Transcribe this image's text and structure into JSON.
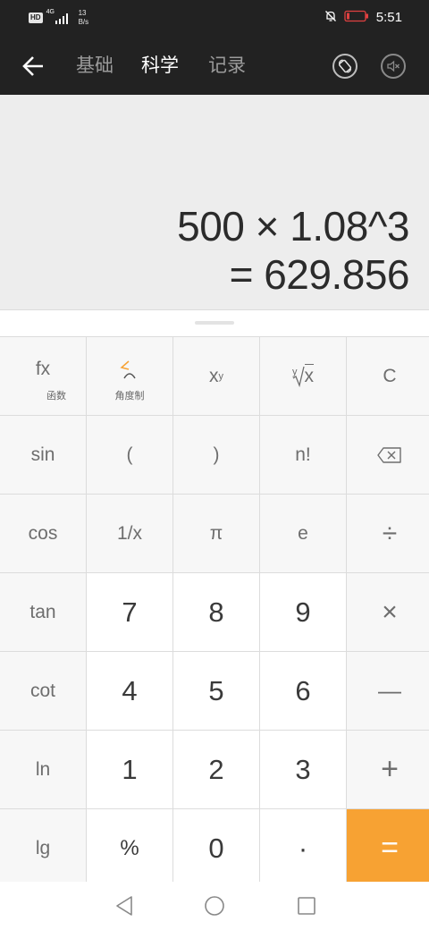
{
  "status_bar": {
    "hd": "HD",
    "signal": "4G",
    "net_speed_value": "13",
    "net_speed_unit": "B/s",
    "time": "5:51"
  },
  "app_bar": {
    "tabs": [
      "基础",
      "科学",
      "记录"
    ],
    "active_tab": "科学"
  },
  "display": {
    "expression": "500 × 1.08^3",
    "result": "= 629.856"
  },
  "keypad": {
    "fx": "fx",
    "fx_sub": "函数",
    "angle_sub": "角度制",
    "power": "x",
    "power_sup": "y",
    "root_index": "y",
    "root_radicand": "x",
    "clear": "C",
    "sin": "sin",
    "lparen": "(",
    "rparen": ")",
    "factorial": "n!",
    "cos": "cos",
    "reciprocal": "1/x",
    "pi": "π",
    "e": "e",
    "divide": "÷",
    "tan": "tan",
    "seven": "7",
    "eight": "8",
    "nine": "9",
    "multiply": "×",
    "cot": "cot",
    "four": "4",
    "five": "5",
    "six": "6",
    "minus": "—",
    "ln": "ln",
    "one": "1",
    "two": "2",
    "three": "3",
    "plus": "+",
    "lg": "lg",
    "percent": "%",
    "zero": "0",
    "dot": "·",
    "equals": "="
  },
  "colors": {
    "accent": "#f7a233",
    "appbar": "#222222",
    "display_bg": "#ededed"
  }
}
